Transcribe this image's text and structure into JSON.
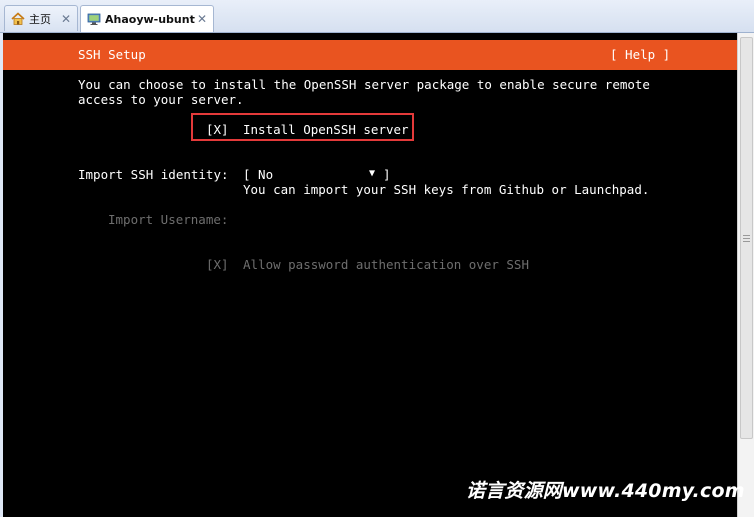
{
  "tabs": [
    {
      "label": "主页",
      "icon": "home-icon",
      "close": "✕"
    },
    {
      "label": "Ahaoyw-ubuntu",
      "icon": "vm-icon",
      "close": "✕"
    }
  ],
  "installer": {
    "title": "SSH Setup",
    "help": "[ Help ]",
    "intro_line1": "You can choose to install the OpenSSH server package to enable secure remote",
    "intro_line2": "access to your server.",
    "install_checkbox": "[X]",
    "install_label": "Install OpenSSH server",
    "identity_label": "Import SSH identity:",
    "identity_select_open": "[ No",
    "identity_select_arrow": "▼",
    "identity_select_close": "]",
    "identity_hint": "You can import your SSH keys from Github or Launchpad.",
    "username_label": "Import Username:",
    "password_checkbox": "[X]",
    "password_label": "Allow password authentication over SSH"
  },
  "watermark": "诺言资源网www.440my.com",
  "colors": {
    "accent": "#e95420",
    "highlight_border": "#e43a3a",
    "terminal_bg": "#000000",
    "dim_text": "#6e6e6e"
  }
}
